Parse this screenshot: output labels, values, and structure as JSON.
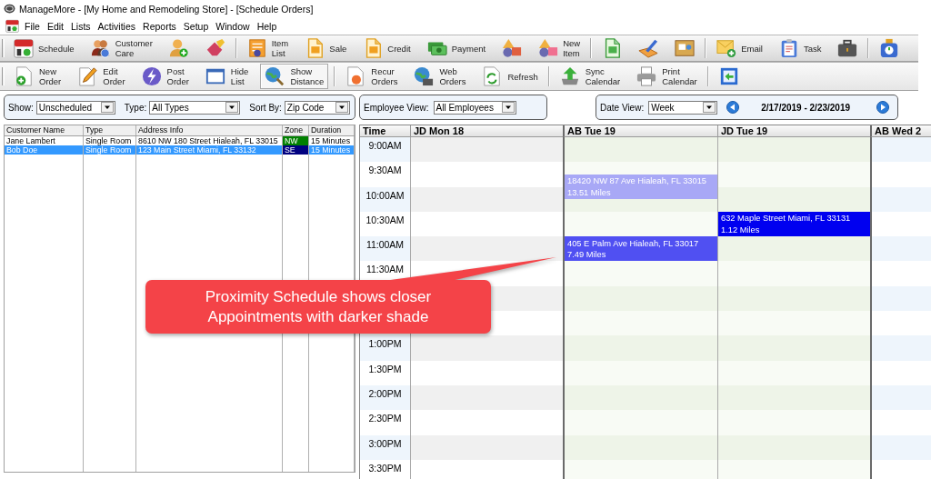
{
  "window": {
    "title": "ManageMore - [My Home and Remodeling Store] - [Schedule Orders]"
  },
  "menu": [
    "File",
    "Edit",
    "Lists",
    "Activities",
    "Reports",
    "Setup",
    "Window",
    "Help"
  ],
  "toolbar1": {
    "items": [
      {
        "kind": "labeled",
        "label": "Schedule"
      },
      {
        "kind": "labeled",
        "label": "Customer Care"
      },
      {
        "kind": "icon"
      },
      {
        "kind": "icon"
      },
      {
        "kind": "separator"
      },
      {
        "kind": "labeled",
        "label": "Item List"
      },
      {
        "kind": "labeled",
        "label": "Sale"
      },
      {
        "kind": "labeled",
        "label": "Credit"
      },
      {
        "kind": "labeled",
        "label": "Payment"
      },
      {
        "kind": "icon"
      },
      {
        "kind": "labeled",
        "label": "New Item"
      },
      {
        "kind": "separator"
      },
      {
        "kind": "icon"
      },
      {
        "kind": "icon"
      },
      {
        "kind": "icon"
      },
      {
        "kind": "separator"
      },
      {
        "kind": "labeled",
        "label": "Email"
      },
      {
        "kind": "labeled",
        "label": "Task"
      },
      {
        "kind": "icon"
      },
      {
        "kind": "separator"
      },
      {
        "kind": "icon"
      }
    ]
  },
  "toolbar2": {
    "items": [
      {
        "kind": "labeled",
        "label": "New Order",
        "pressed": false
      },
      {
        "kind": "labeled",
        "label": "Edit Order",
        "pressed": false
      },
      {
        "kind": "labeled",
        "label": "Post Order",
        "pressed": false
      },
      {
        "kind": "labeled",
        "label": "Hide List",
        "pressed": false
      },
      {
        "kind": "labeled",
        "label": "Show Distance",
        "pressed": true
      },
      {
        "kind": "separator"
      },
      {
        "kind": "labeled",
        "label": "Recur Orders",
        "pressed": false
      },
      {
        "kind": "labeled",
        "label": "Web Orders",
        "pressed": false
      },
      {
        "kind": "labeled",
        "label": "Refresh",
        "pressed": false
      },
      {
        "kind": "separator"
      },
      {
        "kind": "labeled",
        "label": "Sync Calendar",
        "pressed": false
      },
      {
        "kind": "labeled",
        "label": "Print Calendar",
        "pressed": false
      },
      {
        "kind": "separator"
      },
      {
        "kind": "icon",
        "pressed": false
      }
    ]
  },
  "filters": [
    {
      "label": "Show:",
      "value": "Unscheduled"
    },
    {
      "label": "Type:",
      "value": "All Types"
    },
    {
      "label": "Sort By:",
      "value": "Zip Code"
    }
  ],
  "orders_table": {
    "columns": [
      "Customer Name",
      "Type",
      "Address Info",
      "Zone",
      "Duration"
    ],
    "rows": [
      {
        "customer_name": "Jane Lambert",
        "type": "Single Room",
        "address": "8610 NW 180 Street Hialeah, FL 33015",
        "zone": {
          "text": "NW",
          "color": "#008000"
        },
        "duration": "15 Minutes",
        "selected": false
      },
      {
        "customer_name": "Bob Doe",
        "type": "Single Room",
        "address": "123 Main Street Miami, FL 33132",
        "zone": {
          "text": "SE",
          "color": "#000080"
        },
        "duration": "15 Minutes",
        "selected": true
      }
    ]
  },
  "employee_view": {
    "label": "Employee View:",
    "value": "All Employees"
  },
  "date_view": {
    "label": "Date View:",
    "value": "Week",
    "range": "2/17/2019 - 2/23/2019"
  },
  "calendar": {
    "time_header": "Time",
    "time_slots": [
      "9:00AM",
      "9:30AM",
      "10:00AM",
      "10:30AM",
      "11:00AM",
      "11:30AM",
      "1:00PM",
      "1:30PM",
      "2:00PM",
      "2:30PM",
      "3:00PM",
      "3:30PM"
    ],
    "columns": [
      {
        "label": "JD Mon 18",
        "kind": "past"
      },
      {
        "label": "AB Tue 19",
        "kind": "today",
        "appointments": [
          {
            "address": "18420 NW 87 Ave Hialeah, FL 33015",
            "distance": "13.51 Miles",
            "color": "#a8a8f6"
          },
          {
            "address": "405 E Palm Ave Hialeah, FL 33017",
            "distance": "7.49 Miles",
            "color": "#5050f2"
          }
        ]
      },
      {
        "label": "JD Tue 19",
        "kind": "today",
        "appointments": [
          {
            "address": "632 Maple Street Miami, FL 33131",
            "distance": "1.12 Miles",
            "color": "#0000f0"
          }
        ]
      },
      {
        "label": "AB Wed 2",
        "kind": "future"
      }
    ]
  },
  "callout": {
    "text": "Proximity Schedule shows closer Appointments with darker shade"
  }
}
